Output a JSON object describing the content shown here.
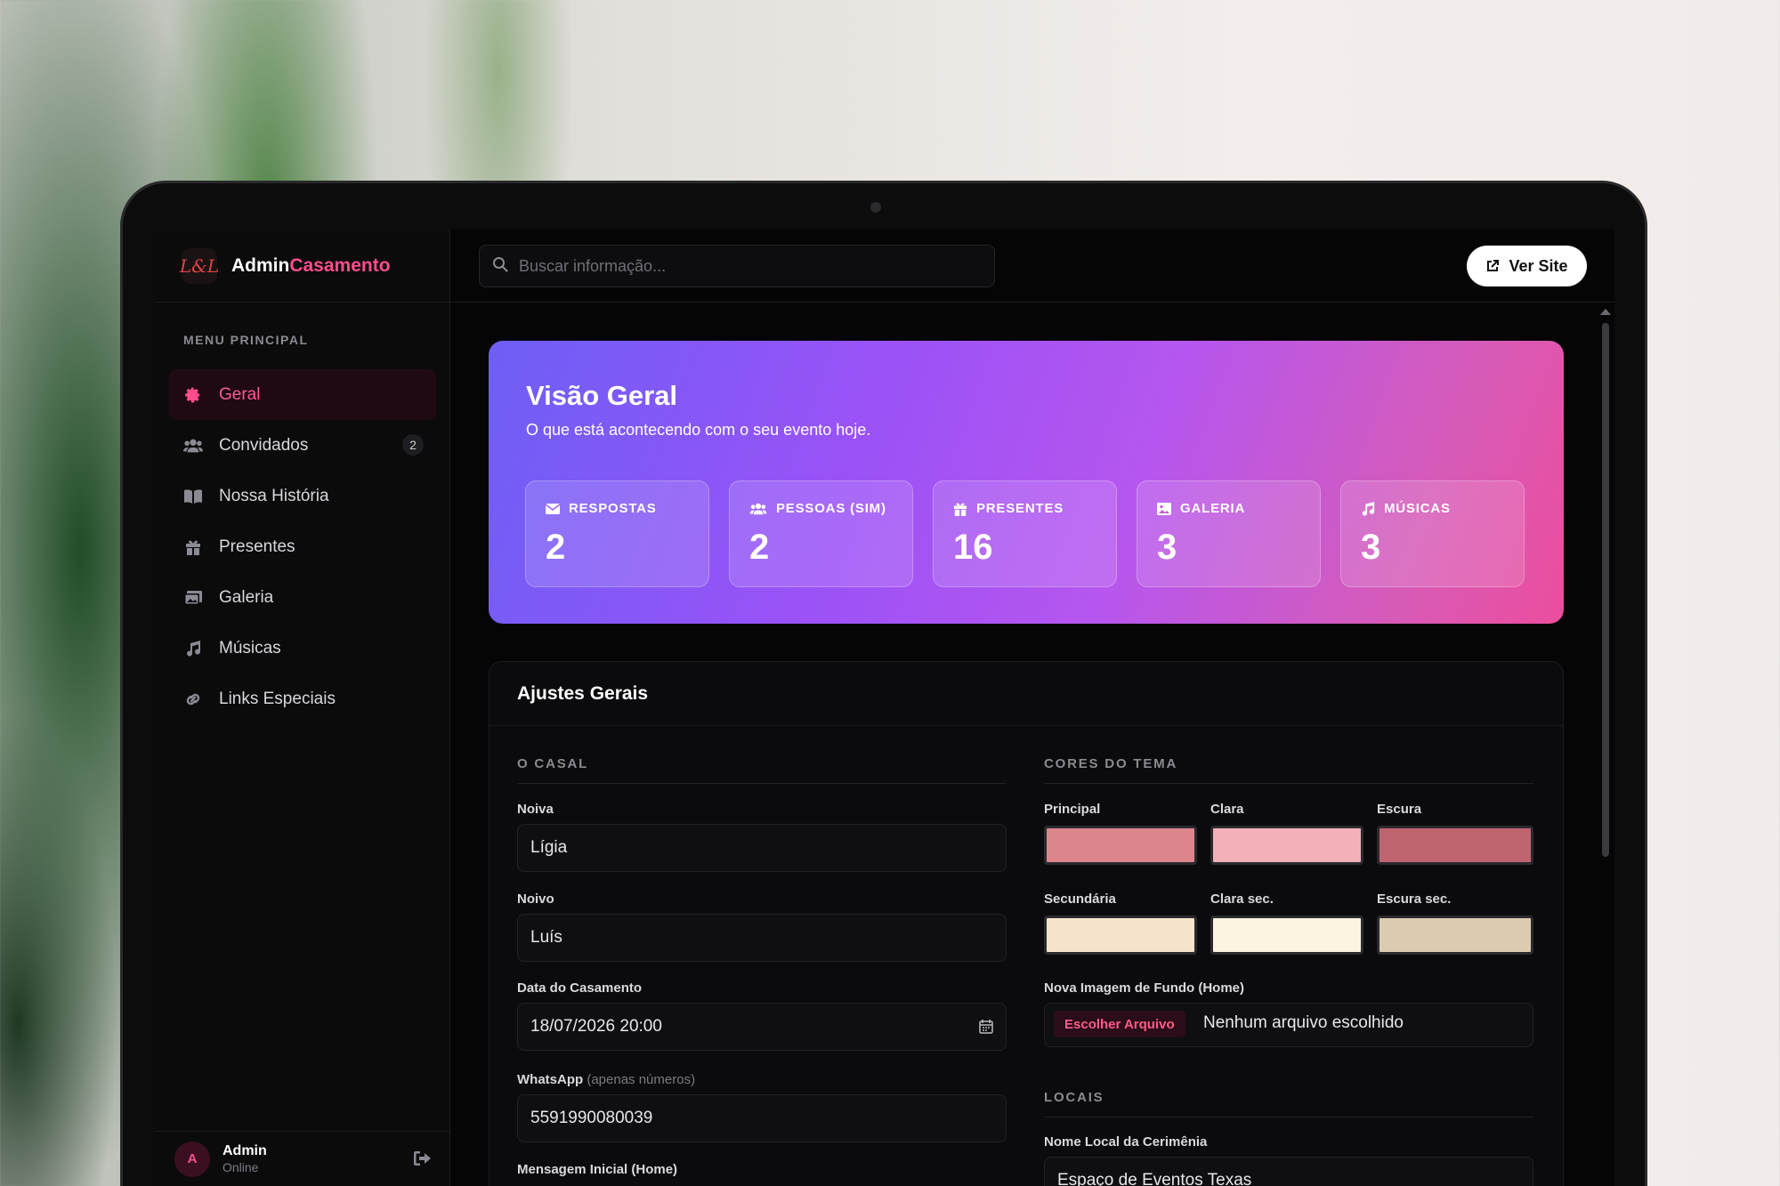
{
  "brand": {
    "logo_text": "L&L",
    "name_part1": "Admin",
    "name_part2": "Casamento"
  },
  "search": {
    "placeholder": "Buscar informação..."
  },
  "header": {
    "ver_site_label": "Ver Site"
  },
  "sidebar": {
    "menu_title": "MENU PRINCIPAL",
    "items": [
      {
        "label": "Geral",
        "icon": "gear-icon",
        "active": true
      },
      {
        "label": "Convidados",
        "icon": "users-icon",
        "badge": "2"
      },
      {
        "label": "Nossa História",
        "icon": "book-icon"
      },
      {
        "label": "Presentes",
        "icon": "gift-icon"
      },
      {
        "label": "Galeria",
        "icon": "images-icon"
      },
      {
        "label": "Músicas",
        "icon": "music-icon"
      },
      {
        "label": "Links Especiais",
        "icon": "link-icon"
      }
    ],
    "user": {
      "initial": "A",
      "name": "Admin",
      "status": "Online"
    }
  },
  "overview": {
    "title": "Visão Geral",
    "subtitle": "O que está acontecendo com o seu evento hoje.",
    "stats": [
      {
        "label": "RESPOSTAS",
        "value": "2",
        "icon": "envelope-icon"
      },
      {
        "label": "PESSOAS (SIM)",
        "value": "2",
        "icon": "users-icon"
      },
      {
        "label": "PRESENTES",
        "value": "16",
        "icon": "gift-icon"
      },
      {
        "label": "GALERIA",
        "value": "3",
        "icon": "image-icon"
      },
      {
        "label": "MÚSICAS",
        "value": "3",
        "icon": "music-icon"
      }
    ]
  },
  "settings": {
    "title": "Ajustes Gerais",
    "casal": {
      "section_title": "O CASAL",
      "noiva_label": "Noiva",
      "noiva_value": "Lígia",
      "noivo_label": "Noivo",
      "noivo_value": "Luís",
      "data_label": "Data do Casamento",
      "data_value": "18/07/2026 20:00",
      "whatsapp_label": "WhatsApp",
      "whatsapp_hint": "(apenas números)",
      "whatsapp_value": "5591990080039",
      "mensagem_label": "Mensagem Inicial (Home)"
    },
    "cores": {
      "section_title": "CORES DO TEMA",
      "swatches": [
        {
          "label": "Principal",
          "color": "#dc858d"
        },
        {
          "label": "Clara",
          "color": "#f4b0b8"
        },
        {
          "label": "Escura",
          "color": "#bf6570"
        },
        {
          "label": "Secundária",
          "color": "#f6e3cb"
        },
        {
          "label": "Clara sec.",
          "color": "#fdf3e1"
        },
        {
          "label": "Escura sec.",
          "color": "#dccbaf"
        }
      ],
      "imagem_label": "Nova Imagem de Fundo (Home)",
      "file_button": "Escolher Arquivo",
      "file_status": "Nenhum arquivo escolhido"
    },
    "locais": {
      "section_title": "LOCAIS",
      "cerimonia_label": "Nome Local da Cerimênia",
      "cerimonia_value": "Espaço de Eventos Texas"
    }
  }
}
